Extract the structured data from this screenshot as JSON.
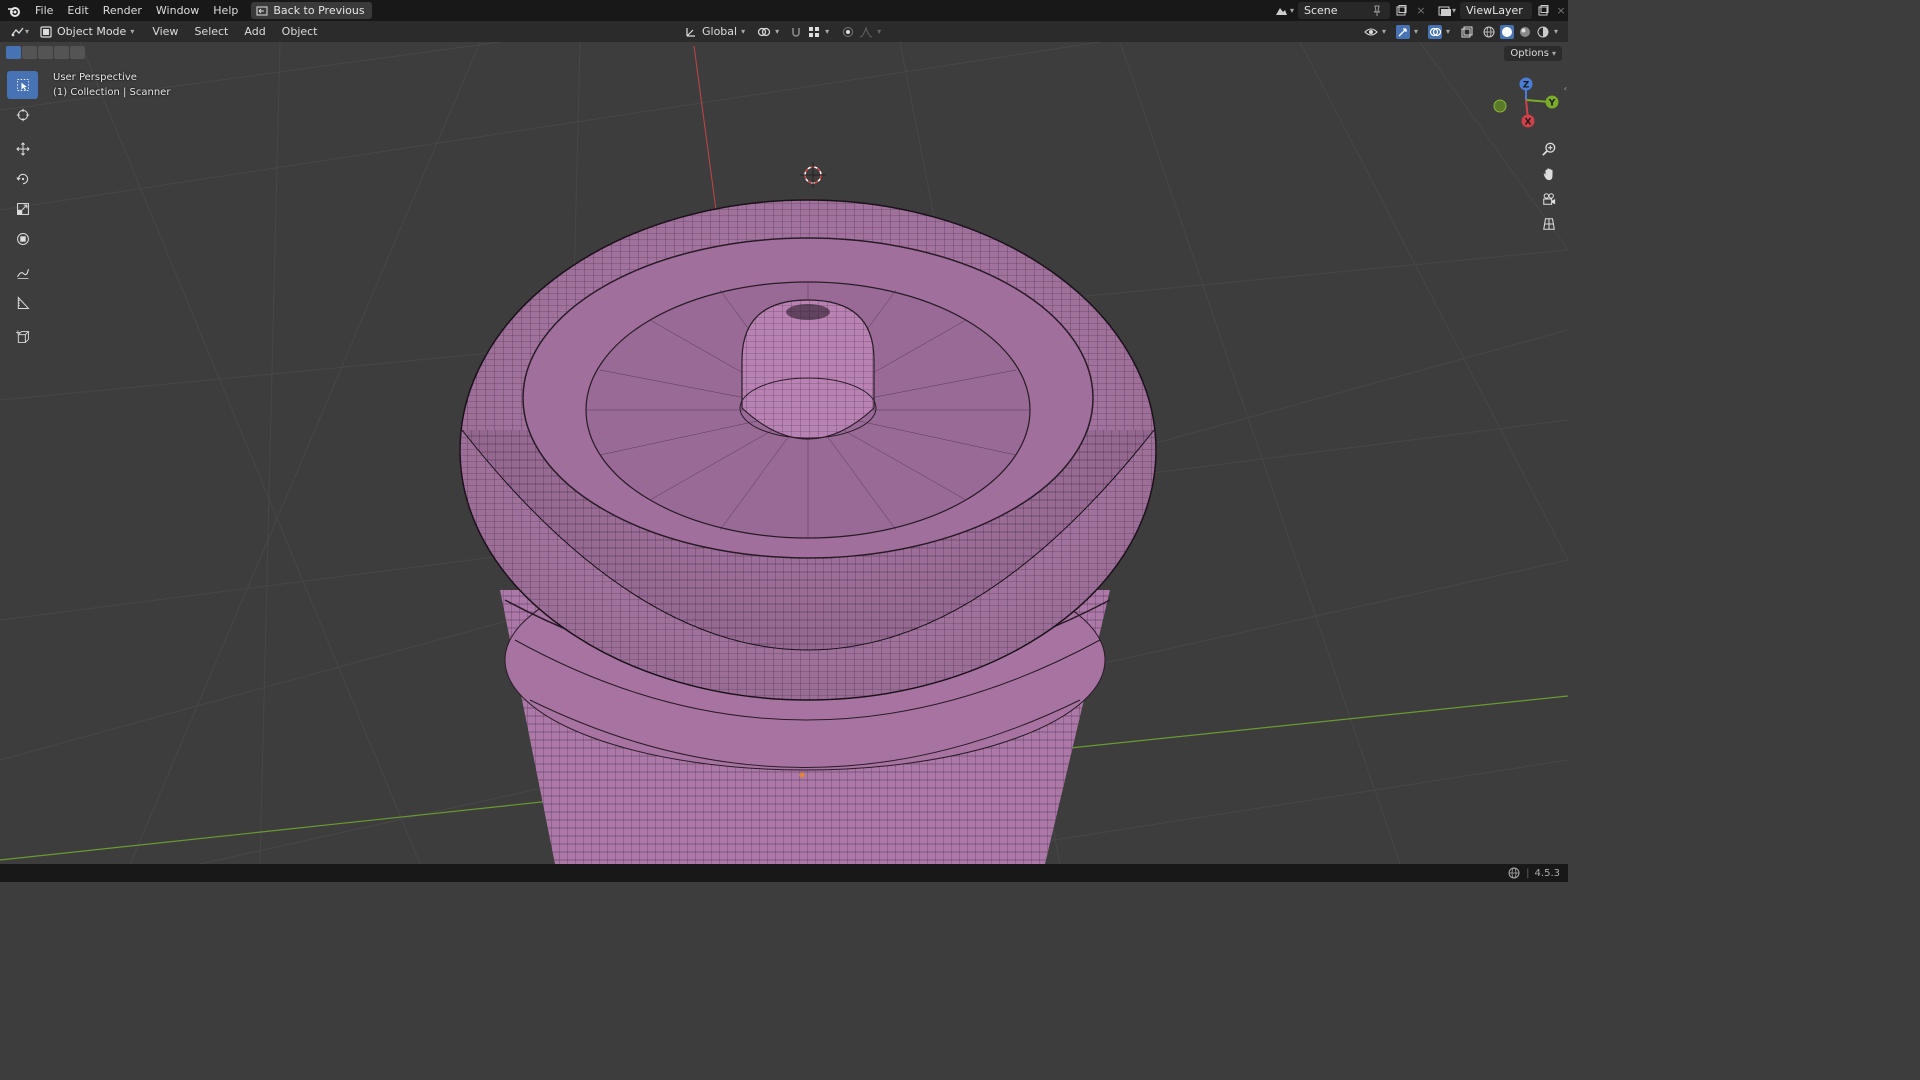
{
  "menu": {
    "items": [
      "File",
      "Edit",
      "Render",
      "Window",
      "Help"
    ],
    "back_label": "Back to Previous"
  },
  "topright": {
    "scene_label": "Scene",
    "viewlayer_label": "ViewLayer"
  },
  "header": {
    "mode_label": "Object Mode",
    "menus": [
      "View",
      "Select",
      "Add",
      "Object"
    ],
    "transform_orientation": "Global"
  },
  "viewport": {
    "perspective_label": "User Perspective",
    "collection_label": "(1) Collection | Scanner",
    "options_label": "Options"
  },
  "gizmo": {
    "x": "X",
    "y": "Y",
    "z": "Z"
  },
  "status": {
    "version": "4.5.3"
  },
  "colors": {
    "mesh": "#b07aab",
    "accent": "#4772b3",
    "grid": "#474747",
    "axis_x": "#c04545",
    "axis_y": "#6a9a32"
  },
  "icons": [
    "blender-logo-icon",
    "back-icon",
    "scene-icon",
    "pin-icon",
    "new-scene-icon",
    "viewlayer-icon",
    "editor-type-icon",
    "object-mode-icon",
    "transform-orientation-icon",
    "pivot-icon",
    "snap-icon",
    "proportional-icon",
    "visibility-icon",
    "gizmo-icon",
    "overlay-icon",
    "xray-icon",
    "shading-wireframe-icon",
    "shading-solid-icon",
    "shading-material-icon",
    "shading-rendered-icon",
    "select-box-icon",
    "cursor-icon",
    "move-icon",
    "rotate-icon",
    "scale-icon",
    "transform-icon",
    "annotate-icon",
    "measure-icon",
    "add-cube-icon",
    "zoom-icon",
    "hand-icon",
    "camera-icon",
    "grid-icon",
    "globe-icon"
  ]
}
